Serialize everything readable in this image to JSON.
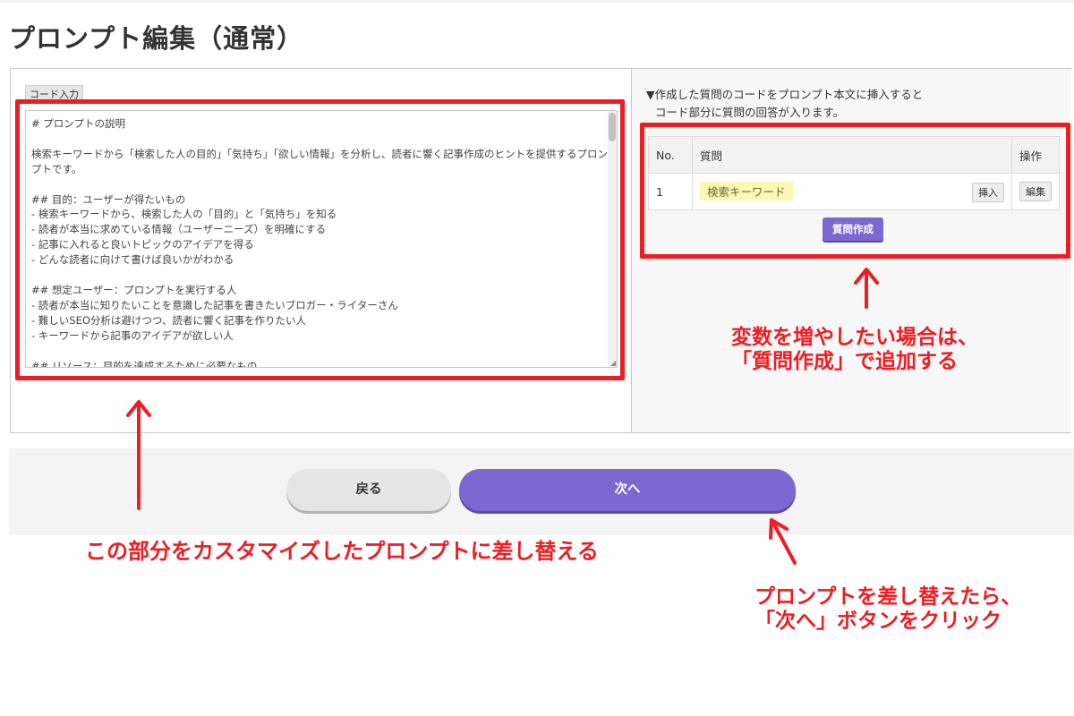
{
  "page": {
    "title": "プロンプト編集（通常）"
  },
  "editor": {
    "code_tag": "コード入力",
    "prompt_text": "# プロンプトの説明\n\n検索キーワードから「検索した人の目的」「気持ち」「欲しい情報」を分析し、読者に響く記事作成のヒントを提供するプロンプトです。\n\n## 目的：ユーザーが得たいもの\n- 検索キーワードから、検索した人の「目的」と「気持ち」を知る\n- 読者が本当に求めている情報（ユーザーニーズ）を明確にする\n- 記事に入れると良いトピックのアイデアを得る\n- どんな読者に向けて書けば良いかがわかる\n\n## 想定ユーザー：プロンプトを実行する人\n- 読者が本当に知りたいことを意識した記事を書きたいブロガー・ライターさん\n- 難しいSEO分析は避けつつ、読者に響く記事を作りたい人\n- キーワードから記事のアイデアが欲しい人\n\n## リソース：目的を達成するために必要なもの"
  },
  "question_panel": {
    "info_line1": "▼作成した質問のコードをプロンプト本文に挿入すると",
    "info_line2": "コード部分に質問の回答が入ります。",
    "columns": {
      "no": "No.",
      "question": "質問",
      "action": "操作"
    },
    "rows": [
      {
        "no": "1",
        "question": "検索キーワード",
        "insert_label": "挿入",
        "edit_label": "編集"
      }
    ],
    "create_button": "質問作成"
  },
  "footer": {
    "back_label": "戻る",
    "next_label": "次へ"
  },
  "annotations": {
    "variable_note": [
      "変数を増やしたい場合は、",
      "「質問作成」で追加する"
    ],
    "replace_note": "この部分をカスタマイズしたプロンプトに差し替える",
    "next_note": [
      "プロンプトを差し替えたら、",
      "「次へ」ボタンをクリック"
    ]
  },
  "colors": {
    "accent_purple": "#7b68d0",
    "annotation_red": "#ee1c23"
  }
}
